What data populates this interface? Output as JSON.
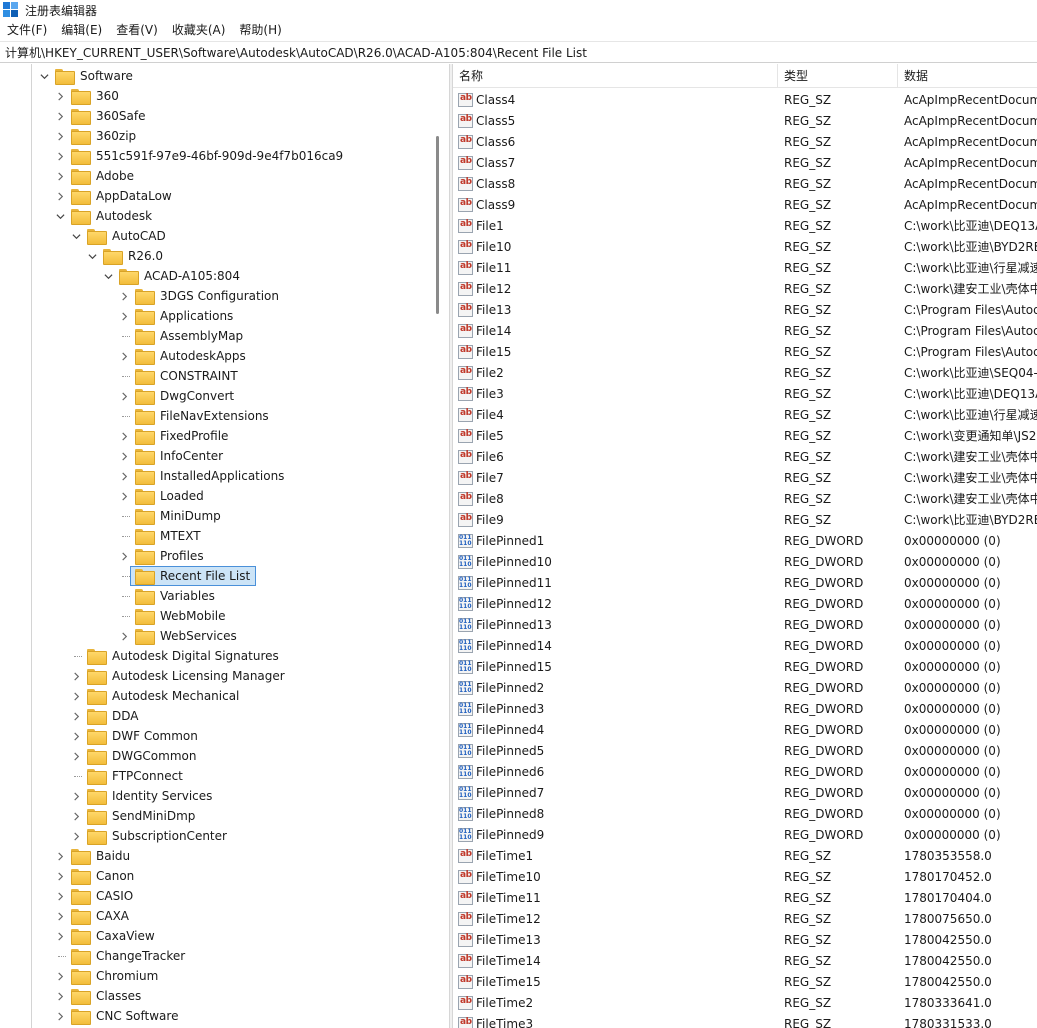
{
  "window": {
    "title": "注册表编辑器",
    "accent": "#1e78d6"
  },
  "menu": [
    "文件(F)",
    "编辑(E)",
    "查看(V)",
    "收藏夹(A)",
    "帮助(H)"
  ],
  "address": "计算机\\HKEY_CURRENT_USER\\Software\\Autodesk\\AutoCAD\\R26.0\\ACAD-A105:804\\Recent File List",
  "tree": [
    {
      "label": "Software",
      "depth": 0,
      "state": "expanded"
    },
    {
      "label": "360",
      "depth": 1,
      "state": "collapsed"
    },
    {
      "label": "360Safe",
      "depth": 1,
      "state": "collapsed"
    },
    {
      "label": "360zip",
      "depth": 1,
      "state": "collapsed"
    },
    {
      "label": "551c591f-97e9-46bf-909d-9e4f7b016ca9",
      "depth": 1,
      "state": "collapsed"
    },
    {
      "label": "Adobe",
      "depth": 1,
      "state": "collapsed"
    },
    {
      "label": "AppDataLow",
      "depth": 1,
      "state": "collapsed"
    },
    {
      "label": "Autodesk",
      "depth": 1,
      "state": "expanded"
    },
    {
      "label": "AutoCAD",
      "depth": 2,
      "state": "expanded"
    },
    {
      "label": "R26.0",
      "depth": 3,
      "state": "expanded"
    },
    {
      "label": "ACAD-A105:804",
      "depth": 4,
      "state": "expanded"
    },
    {
      "label": "3DGS Configuration",
      "depth": 5,
      "state": "collapsed"
    },
    {
      "label": "Applications",
      "depth": 5,
      "state": "collapsed"
    },
    {
      "label": "AssemblyMap",
      "depth": 5,
      "state": "leaf"
    },
    {
      "label": "AutodeskApps",
      "depth": 5,
      "state": "collapsed"
    },
    {
      "label": "CONSTRAINT",
      "depth": 5,
      "state": "leaf"
    },
    {
      "label": "DwgConvert",
      "depth": 5,
      "state": "collapsed"
    },
    {
      "label": "FileNavExtensions",
      "depth": 5,
      "state": "leaf"
    },
    {
      "label": "FixedProfile",
      "depth": 5,
      "state": "collapsed"
    },
    {
      "label": "InfoCenter",
      "depth": 5,
      "state": "collapsed"
    },
    {
      "label": "InstalledApplications",
      "depth": 5,
      "state": "collapsed"
    },
    {
      "label": "Loaded",
      "depth": 5,
      "state": "collapsed"
    },
    {
      "label": "MiniDump",
      "depth": 5,
      "state": "leaf"
    },
    {
      "label": "MTEXT",
      "depth": 5,
      "state": "leaf"
    },
    {
      "label": "Profiles",
      "depth": 5,
      "state": "collapsed"
    },
    {
      "label": "Recent File List",
      "depth": 5,
      "state": "leaf",
      "selected": true
    },
    {
      "label": "Variables",
      "depth": 5,
      "state": "leaf"
    },
    {
      "label": "WebMobile",
      "depth": 5,
      "state": "leaf"
    },
    {
      "label": "WebServices",
      "depth": 5,
      "state": "collapsed"
    },
    {
      "label": "Autodesk Digital Signatures",
      "depth": 2,
      "state": "leaf"
    },
    {
      "label": "Autodesk Licensing Manager",
      "depth": 2,
      "state": "collapsed"
    },
    {
      "label": "Autodesk Mechanical",
      "depth": 2,
      "state": "collapsed"
    },
    {
      "label": "DDA",
      "depth": 2,
      "state": "collapsed"
    },
    {
      "label": "DWF Common",
      "depth": 2,
      "state": "collapsed"
    },
    {
      "label": "DWGCommon",
      "depth": 2,
      "state": "collapsed"
    },
    {
      "label": "FTPConnect",
      "depth": 2,
      "state": "leaf"
    },
    {
      "label": "Identity Services",
      "depth": 2,
      "state": "collapsed"
    },
    {
      "label": "SendMiniDmp",
      "depth": 2,
      "state": "collapsed"
    },
    {
      "label": "SubscriptionCenter",
      "depth": 2,
      "state": "collapsed"
    },
    {
      "label": "Baidu",
      "depth": 1,
      "state": "collapsed"
    },
    {
      "label": "Canon",
      "depth": 1,
      "state": "collapsed"
    },
    {
      "label": "CASIO",
      "depth": 1,
      "state": "collapsed"
    },
    {
      "label": "CAXA",
      "depth": 1,
      "state": "collapsed"
    },
    {
      "label": "CaxaView",
      "depth": 1,
      "state": "collapsed"
    },
    {
      "label": "ChangeTracker",
      "depth": 1,
      "state": "leaf"
    },
    {
      "label": "Chromium",
      "depth": 1,
      "state": "collapsed"
    },
    {
      "label": "Classes",
      "depth": 1,
      "state": "collapsed"
    },
    {
      "label": "CNC Software",
      "depth": 1,
      "state": "collapsed"
    }
  ],
  "list": {
    "headers": {
      "name": "名称",
      "type": "类型",
      "data": "数据"
    },
    "rows": [
      {
        "name": "Class4",
        "icon": "string-value-icon",
        "type": "REG_SZ",
        "data": "AcApImpRecentDocum"
      },
      {
        "name": "Class5",
        "icon": "string-value-icon",
        "type": "REG_SZ",
        "data": "AcApImpRecentDocum"
      },
      {
        "name": "Class6",
        "icon": "string-value-icon",
        "type": "REG_SZ",
        "data": "AcApImpRecentDocum"
      },
      {
        "name": "Class7",
        "icon": "string-value-icon",
        "type": "REG_SZ",
        "data": "AcApImpRecentDocum"
      },
      {
        "name": "Class8",
        "icon": "string-value-icon",
        "type": "REG_SZ",
        "data": "AcApImpRecentDocum"
      },
      {
        "name": "Class9",
        "icon": "string-value-icon",
        "type": "REG_SZ",
        "data": "AcApImpRecentDocum"
      },
      {
        "name": "File1",
        "icon": "string-value-icon",
        "type": "REG_SZ",
        "data": "C:\\work\\比亚迪\\DEQ13A"
      },
      {
        "name": "File10",
        "icon": "string-value-icon",
        "type": "REG_SZ",
        "data": "C:\\work\\比亚迪\\BYD2RE"
      },
      {
        "name": "File11",
        "icon": "string-value-icon",
        "type": "REG_SZ",
        "data": "C:\\work\\比亚迪\\行星减速"
      },
      {
        "name": "File12",
        "icon": "string-value-icon",
        "type": "REG_SZ",
        "data": "C:\\work\\建安工业\\壳体中"
      },
      {
        "name": "File13",
        "icon": "string-value-icon",
        "type": "REG_SZ",
        "data": "C:\\Program Files\\Autod"
      },
      {
        "name": "File14",
        "icon": "string-value-icon",
        "type": "REG_SZ",
        "data": "C:\\Program Files\\Autod"
      },
      {
        "name": "File15",
        "icon": "string-value-icon",
        "type": "REG_SZ",
        "data": "C:\\Program Files\\Autod"
      },
      {
        "name": "File2",
        "icon": "string-value-icon",
        "type": "REG_SZ",
        "data": "C:\\work\\比亚迪\\SEQ04-"
      },
      {
        "name": "File3",
        "icon": "string-value-icon",
        "type": "REG_SZ",
        "data": "C:\\work\\比亚迪\\DEQ13A"
      },
      {
        "name": "File4",
        "icon": "string-value-icon",
        "type": "REG_SZ",
        "data": "C:\\work\\比亚迪\\行星减速"
      },
      {
        "name": "File5",
        "icon": "string-value-icon",
        "type": "REG_SZ",
        "data": "C:\\work\\变更通知单\\JS2"
      },
      {
        "name": "File6",
        "icon": "string-value-icon",
        "type": "REG_SZ",
        "data": "C:\\work\\建安工业\\壳体中"
      },
      {
        "name": "File7",
        "icon": "string-value-icon",
        "type": "REG_SZ",
        "data": "C:\\work\\建安工业\\壳体中"
      },
      {
        "name": "File8",
        "icon": "string-value-icon",
        "type": "REG_SZ",
        "data": "C:\\work\\建安工业\\壳体中"
      },
      {
        "name": "File9",
        "icon": "string-value-icon",
        "type": "REG_SZ",
        "data": "C:\\work\\比亚迪\\BYD2RE"
      },
      {
        "name": "FilePinned1",
        "icon": "dword-value-icon",
        "type": "REG_DWORD",
        "data": "0x00000000 (0)"
      },
      {
        "name": "FilePinned10",
        "icon": "dword-value-icon",
        "type": "REG_DWORD",
        "data": "0x00000000 (0)"
      },
      {
        "name": "FilePinned11",
        "icon": "dword-value-icon",
        "type": "REG_DWORD",
        "data": "0x00000000 (0)"
      },
      {
        "name": "FilePinned12",
        "icon": "dword-value-icon",
        "type": "REG_DWORD",
        "data": "0x00000000 (0)"
      },
      {
        "name": "FilePinned13",
        "icon": "dword-value-icon",
        "type": "REG_DWORD",
        "data": "0x00000000 (0)"
      },
      {
        "name": "FilePinned14",
        "icon": "dword-value-icon",
        "type": "REG_DWORD",
        "data": "0x00000000 (0)"
      },
      {
        "name": "FilePinned15",
        "icon": "dword-value-icon",
        "type": "REG_DWORD",
        "data": "0x00000000 (0)"
      },
      {
        "name": "FilePinned2",
        "icon": "dword-value-icon",
        "type": "REG_DWORD",
        "data": "0x00000000 (0)"
      },
      {
        "name": "FilePinned3",
        "icon": "dword-value-icon",
        "type": "REG_DWORD",
        "data": "0x00000000 (0)"
      },
      {
        "name": "FilePinned4",
        "icon": "dword-value-icon",
        "type": "REG_DWORD",
        "data": "0x00000000 (0)"
      },
      {
        "name": "FilePinned5",
        "icon": "dword-value-icon",
        "type": "REG_DWORD",
        "data": "0x00000000 (0)"
      },
      {
        "name": "FilePinned6",
        "icon": "dword-value-icon",
        "type": "REG_DWORD",
        "data": "0x00000000 (0)"
      },
      {
        "name": "FilePinned7",
        "icon": "dword-value-icon",
        "type": "REG_DWORD",
        "data": "0x00000000 (0)"
      },
      {
        "name": "FilePinned8",
        "icon": "dword-value-icon",
        "type": "REG_DWORD",
        "data": "0x00000000 (0)"
      },
      {
        "name": "FilePinned9",
        "icon": "dword-value-icon",
        "type": "REG_DWORD",
        "data": "0x00000000 (0)"
      },
      {
        "name": "FileTime1",
        "icon": "string-value-icon",
        "type": "REG_SZ",
        "data": "1780353558.0"
      },
      {
        "name": "FileTime10",
        "icon": "string-value-icon",
        "type": "REG_SZ",
        "data": "1780170452.0"
      },
      {
        "name": "FileTime11",
        "icon": "string-value-icon",
        "type": "REG_SZ",
        "data": "1780170404.0"
      },
      {
        "name": "FileTime12",
        "icon": "string-value-icon",
        "type": "REG_SZ",
        "data": "1780075650.0"
      },
      {
        "name": "FileTime13",
        "icon": "string-value-icon",
        "type": "REG_SZ",
        "data": "1780042550.0"
      },
      {
        "name": "FileTime14",
        "icon": "string-value-icon",
        "type": "REG_SZ",
        "data": "1780042550.0"
      },
      {
        "name": "FileTime15",
        "icon": "string-value-icon",
        "type": "REG_SZ",
        "data": "1780042550.0"
      },
      {
        "name": "FileTime2",
        "icon": "string-value-icon",
        "type": "REG_SZ",
        "data": "1780333641.0"
      },
      {
        "name": "FileTime3",
        "icon": "string-value-icon",
        "type": "REG_SZ",
        "data": "1780331533.0"
      }
    ]
  }
}
